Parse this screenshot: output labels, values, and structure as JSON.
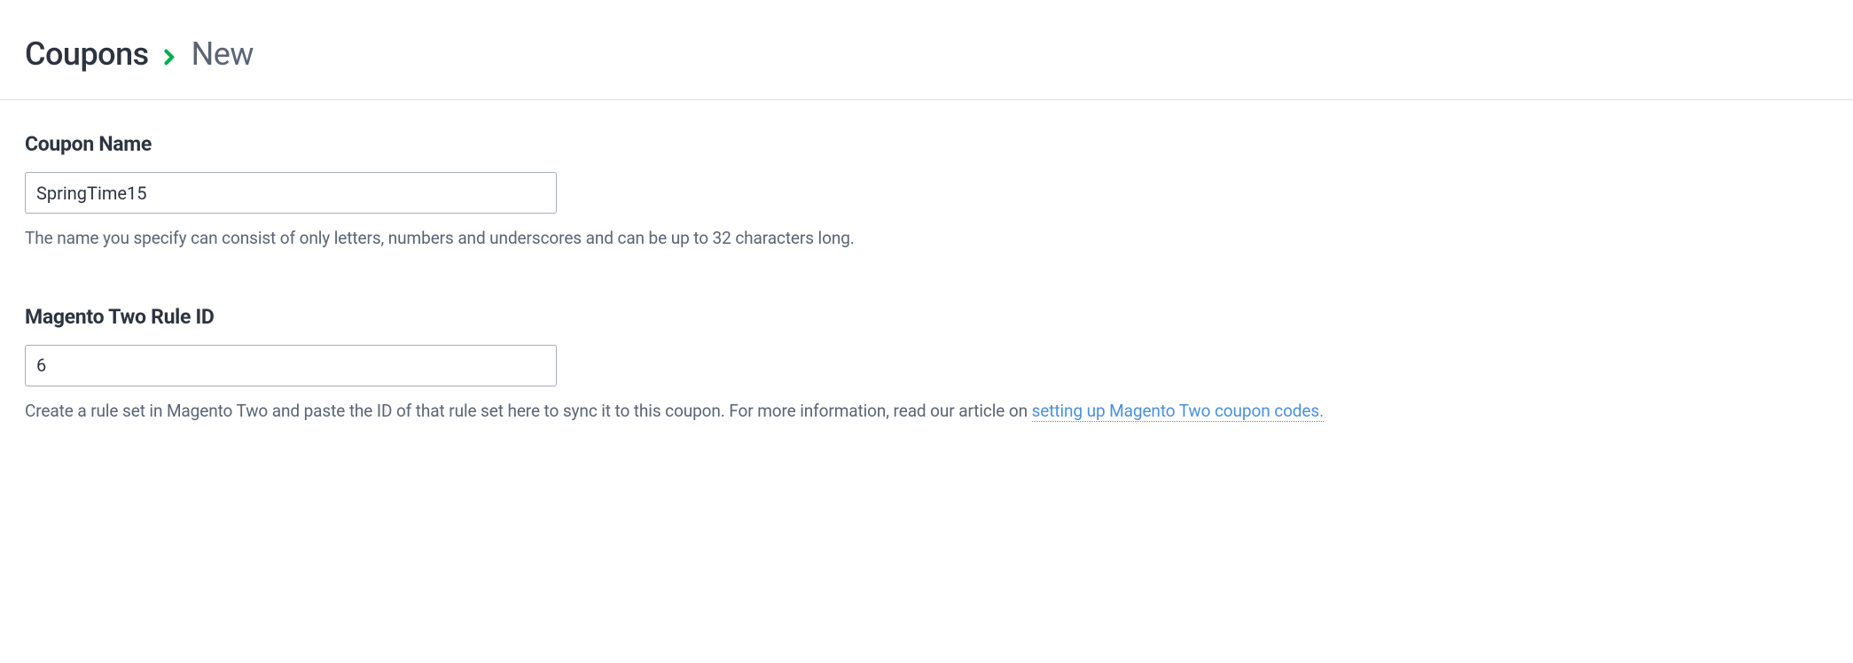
{
  "breadcrumb": {
    "root": "Coupons",
    "current": "New"
  },
  "form": {
    "couponName": {
      "label": "Coupon Name",
      "value": "SpringTime15",
      "help": "The name you specify can consist of only letters, numbers and underscores and can be up to 32 characters long."
    },
    "ruleId": {
      "label": "Magento Two Rule ID",
      "value": "6",
      "helpPrefix": "Create a rule set in Magento Two and paste the ID of that rule set here to sync it to this coupon. For more information, read our article on ",
      "helpLinkText": "setting up Magento Two coupon codes."
    }
  }
}
